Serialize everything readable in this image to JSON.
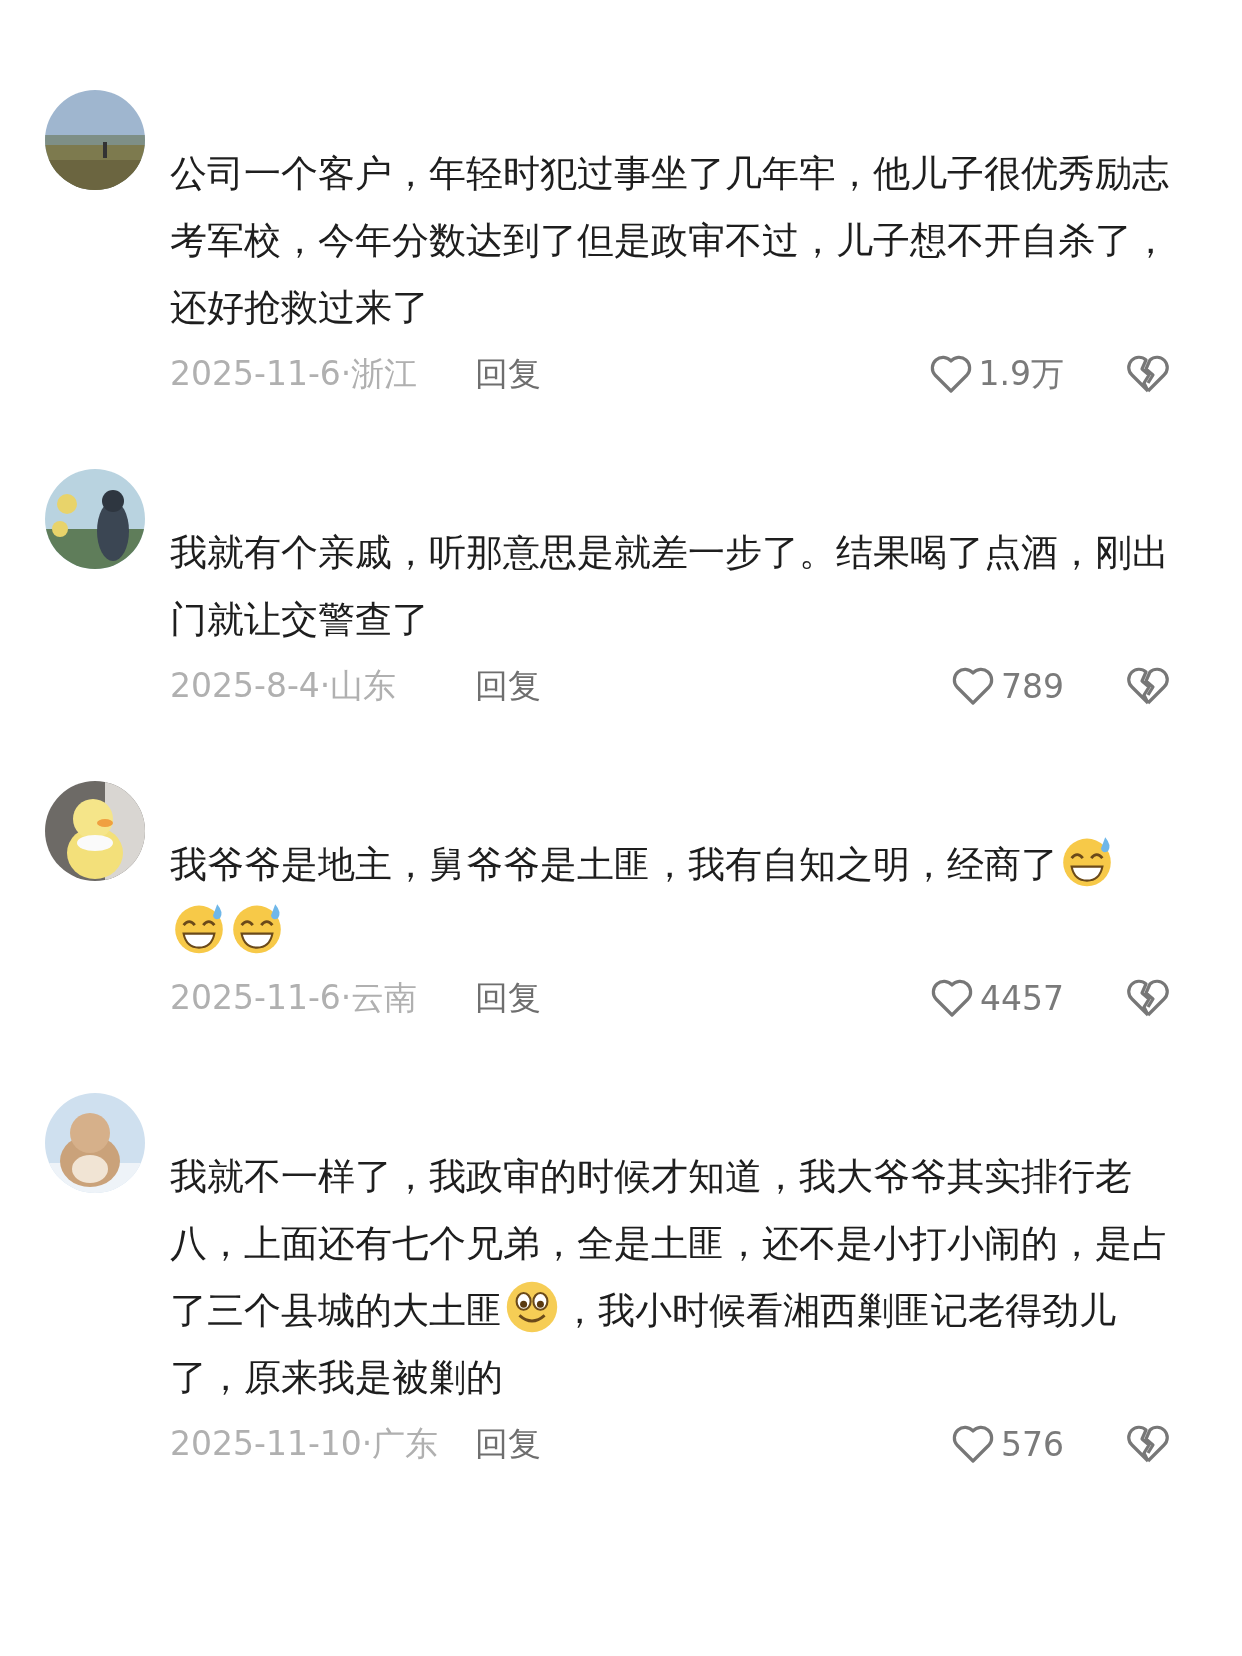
{
  "comments": [
    {
      "body": [
        {
          "kind": "text",
          "text": "公司一个客户，年轻时犯过事坐了几年牢，他儿子很优秀励志考军校，今年分数达到了但是政审不过，儿子想不开自杀了，还好抢救过来了"
        }
      ],
      "meta": "2025-11-6·浙江",
      "reply": "回复",
      "likes": "1.9万"
    },
    {
      "body": [
        {
          "kind": "text",
          "text": "我就有个亲戚，听那意思是就差一步了。结果喝了点酒，刚出门就让交警查了"
        }
      ],
      "meta": "2025-8-4·山东",
      "reply": "回复",
      "likes": "789"
    },
    {
      "body": [
        {
          "kind": "text",
          "text": "我爷爷是地主，舅爷爷是土匪，我有自知之明，经商了"
        },
        {
          "kind": "sweat"
        },
        {
          "kind": "sweat"
        },
        {
          "kind": "sweat"
        }
      ],
      "meta": "2025-11-6·云南",
      "reply": "回复",
      "likes": "4457"
    },
    {
      "body": [
        {
          "kind": "text",
          "text": "我就不一样了，我政审的时候才知道，我大爷爷其实排行老八，上面还有七个兄弟，全是土匪，还不是小打小闹的，是占了三个县城的大土匪"
        },
        {
          "kind": "smile"
        },
        {
          "kind": "text",
          "text": "，我小时候看湘西剿匪记老得劲儿了，原来我是被剿的"
        }
      ],
      "meta": "2025-11-10·广东",
      "reply": "回复",
      "likes": "576"
    }
  ]
}
